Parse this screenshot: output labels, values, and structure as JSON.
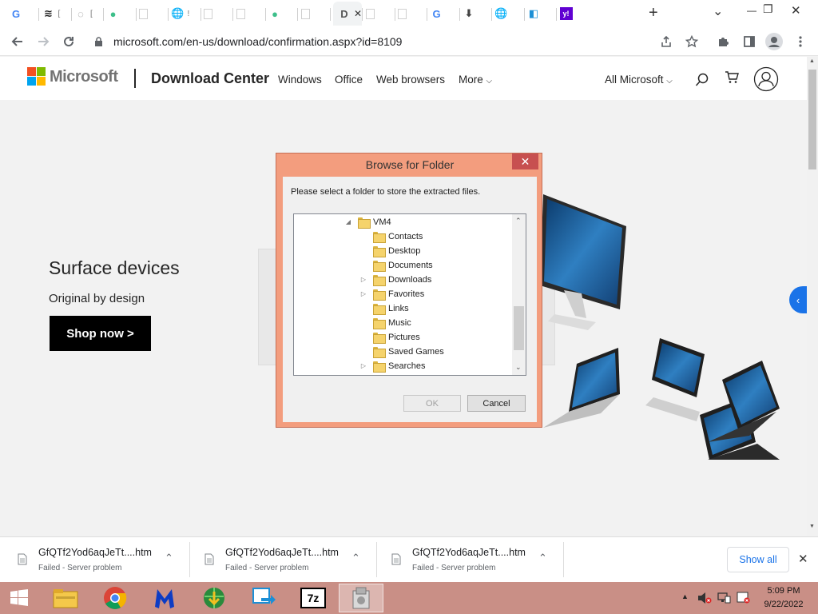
{
  "browser": {
    "tabs": [
      {
        "icon": "google-icon",
        "glyph": "G",
        "color": "#4285f4",
        "frag": ""
      },
      {
        "icon": "tab-icon",
        "glyph": "≋",
        "color": "#222222",
        "frag": "["
      },
      {
        "icon": "loading-icon",
        "glyph": "◌",
        "color": "#888888",
        "frag": "["
      },
      {
        "icon": "download-site-icon",
        "glyph": "●",
        "color": "#3dbf8a",
        "frag": ""
      },
      {
        "icon": "blank-tab-icon",
        "glyph": "",
        "color": "#888888",
        "frag": ""
      },
      {
        "icon": "globe-icon",
        "glyph": "🌐",
        "color": "#555555",
        "frag": "!"
      },
      {
        "icon": "blank-tab-icon",
        "glyph": "",
        "color": "#888888",
        "frag": ""
      },
      {
        "icon": "blank-tab-icon",
        "glyph": "",
        "color": "#888888",
        "frag": ""
      },
      {
        "icon": "download-site-icon",
        "glyph": "●",
        "color": "#3dbf8a",
        "frag": ""
      },
      {
        "icon": "blank-tab-icon",
        "glyph": "",
        "color": "#888888",
        "frag": ""
      },
      {
        "icon": "doc-icon",
        "glyph": "D",
        "color": "#555555",
        "frag": ""
      },
      {
        "icon": "blank-tab-icon",
        "glyph": "",
        "color": "#888888",
        "frag": ""
      },
      {
        "icon": "blank-tab-icon",
        "glyph": "",
        "color": "#888888",
        "frag": ""
      },
      {
        "icon": "google-icon",
        "glyph": "G",
        "color": "#4285f4",
        "frag": ""
      },
      {
        "icon": "download-icon",
        "glyph": "⬇",
        "color": "#444444",
        "frag": ""
      },
      {
        "icon": "globe-icon",
        "glyph": "🌐",
        "color": "#555555",
        "frag": ""
      },
      {
        "icon": "app-icon",
        "glyph": "◧",
        "color": "#1b8fd6",
        "frag": ""
      },
      {
        "icon": "yahoo-icon",
        "glyph": "y!",
        "color": "#6001d2",
        "frag": ""
      }
    ],
    "new_tab": "+",
    "url": "microsoft.com/en-us/download/confirmation.aspx?id=8109"
  },
  "site": {
    "brand": "Microsoft",
    "section": "Download Center",
    "nav": [
      "Windows",
      "Office",
      "Web browsers",
      "More"
    ],
    "all_microsoft": "All Microsoft",
    "hero_title": "Surface devices",
    "hero_subtitle": "Original by design",
    "hero_cta": "Shop now >"
  },
  "dialog": {
    "title": "Browse for Folder",
    "prompt": "Please select a folder to store the extracted files.",
    "tree": [
      {
        "label": "VM4",
        "expander": "◢",
        "root": true
      },
      {
        "label": "Contacts",
        "expander": ""
      },
      {
        "label": "Desktop",
        "expander": ""
      },
      {
        "label": "Documents",
        "expander": ""
      },
      {
        "label": "Downloads",
        "expander": "▷"
      },
      {
        "label": "Favorites",
        "expander": "▷"
      },
      {
        "label": "Links",
        "expander": ""
      },
      {
        "label": "Music",
        "expander": ""
      },
      {
        "label": "Pictures",
        "expander": ""
      },
      {
        "label": "Saved Games",
        "expander": ""
      },
      {
        "label": "Searches",
        "expander": "▷"
      }
    ],
    "ok": "OK",
    "cancel": "Cancel"
  },
  "downloads": {
    "items": [
      {
        "name": "GfQTf2Yod6aqJeTt....htm",
        "status": "Failed - Server problem"
      },
      {
        "name": "GfQTf2Yod6aqJeTt....htm",
        "status": "Failed - Server problem"
      },
      {
        "name": "GfQTf2Yod6aqJeTt....htm",
        "status": "Failed - Server problem"
      }
    ],
    "show_all": "Show all"
  },
  "taskbar": {
    "apps": [
      "start-icon",
      "file-explorer-icon",
      "chrome-icon",
      "malwarebytes-icon",
      "internet-download-manager-icon",
      "remote-app-icon",
      "7zip-icon",
      "installer-icon"
    ],
    "sevenzip_label": "7z",
    "time": "5:09 PM",
    "date": "9/22/2022"
  }
}
